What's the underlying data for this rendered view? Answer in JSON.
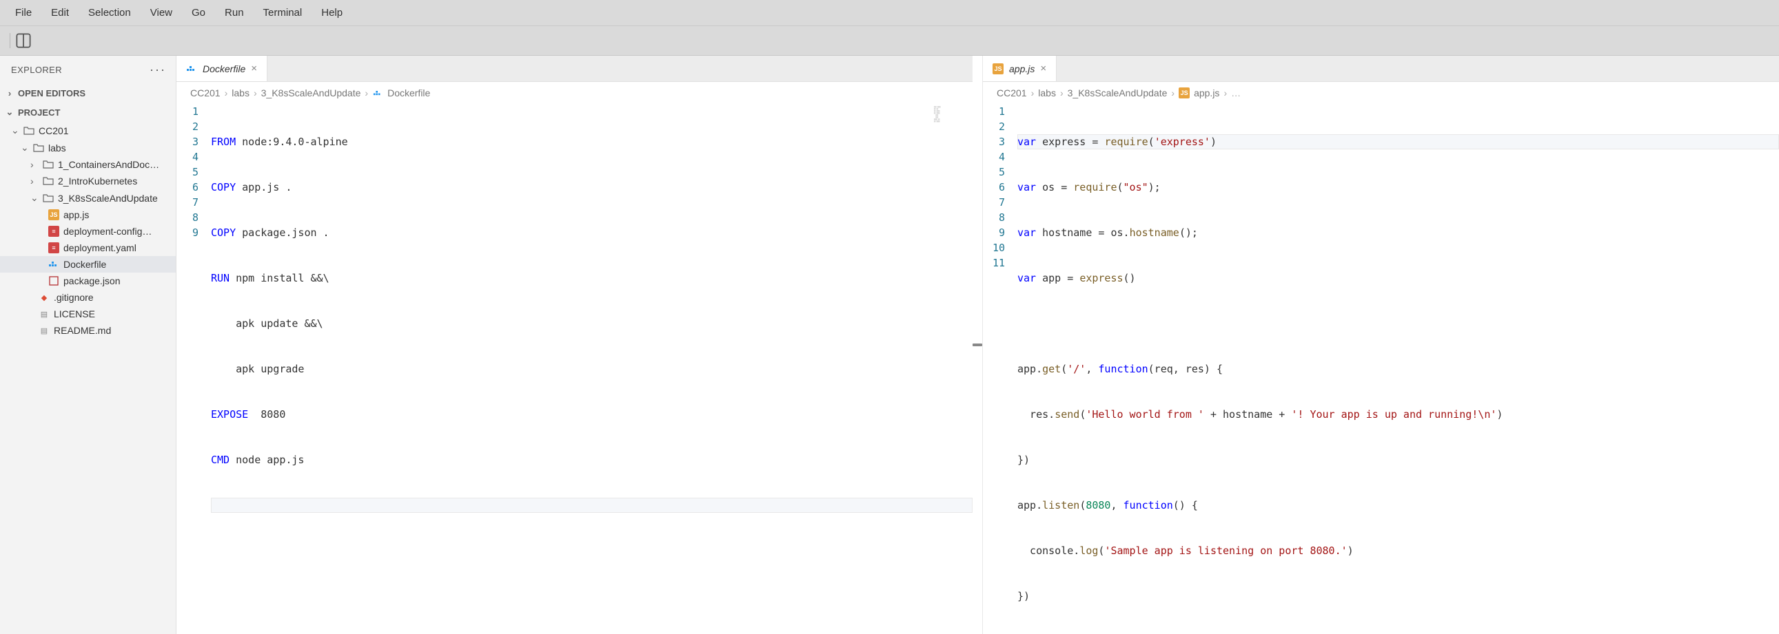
{
  "menu": [
    "File",
    "Edit",
    "Selection",
    "View",
    "Go",
    "Run",
    "Terminal",
    "Help"
  ],
  "sidebar": {
    "title": "EXPLORER",
    "sections": {
      "openEditors": "OPEN EDITORS",
      "project": "PROJECT"
    },
    "tree": {
      "root": "CC201",
      "labs": "labs",
      "folder1": "1_ContainersAndDoc…",
      "folder2": "2_IntroKubernetes",
      "folder3": "3_K8sScaleAndUpdate",
      "files": {
        "appjs": "app.js",
        "depcfg": "deployment-config…",
        "depyaml": "deployment.yaml",
        "dockerfile": "Dockerfile",
        "pkg": "package.json"
      },
      "gitignore": ".gitignore",
      "license": "LICENSE",
      "readme": "README.md"
    }
  },
  "editorLeft": {
    "tab": {
      "label": "Dockerfile"
    },
    "breadcrumb": [
      "CC201",
      "labs",
      "3_K8sScaleAndUpdate",
      "Dockerfile"
    ],
    "lines": [
      {
        "n": 1,
        "t": "FROM",
        "rest": " node:9.4.0-alpine"
      },
      {
        "n": 2,
        "t": "COPY",
        "rest": " app.js ."
      },
      {
        "n": 3,
        "t": "COPY",
        "rest": " package.json ."
      },
      {
        "n": 4,
        "t": "RUN",
        "rest": " npm install &&\\"
      },
      {
        "n": 5,
        "t": "",
        "rest": "    apk update &&\\"
      },
      {
        "n": 6,
        "t": "",
        "rest": "    apk upgrade"
      },
      {
        "n": 7,
        "t": "EXPOSE",
        "rest": "  8080"
      },
      {
        "n": 8,
        "t": "CMD",
        "rest": " node app.js"
      },
      {
        "n": 9,
        "t": "",
        "rest": ""
      }
    ]
  },
  "editorRight": {
    "tab": {
      "label": "app.js"
    },
    "breadcrumb": [
      "CC201",
      "labs",
      "3_K8sScaleAndUpdate",
      "app.js",
      "…"
    ],
    "code": {
      "l1": {
        "a": "var",
        "b": " express = ",
        "fn": "require",
        "c": "(",
        "s": "'express'",
        "d": ")"
      },
      "l2": {
        "a": "var",
        "b": " os = ",
        "fn": "require",
        "c": "(",
        "s": "\"os\"",
        "d": ");"
      },
      "l3": {
        "a": "var",
        "b": " hostname = os.",
        "fn": "hostname",
        "c": "();"
      },
      "l4": {
        "a": "var",
        "b": " app = ",
        "fn": "express",
        "c": "()"
      },
      "l6": {
        "a": "app.",
        "fn": "get",
        "b": "(",
        "s": "'/'",
        "c": ", ",
        "kw": "function",
        "d": "(req, res) {"
      },
      "l7": {
        "a": "  res.",
        "fn": "send",
        "b": "(",
        "s": "'Hello world from '",
        "c": " + hostname + ",
        "s2": "'! Your app is up and running!\\n'",
        "d": ")"
      },
      "l8": {
        "a": "})"
      },
      "l9": {
        "a": "app.",
        "fn": "listen",
        "b": "(",
        "n": "8080",
        "c": ", ",
        "kw": "function",
        "d": "() {"
      },
      "l10": {
        "a": "  console.",
        "fn": "log",
        "b": "(",
        "s": "'Sample app is listening on port 8080.'",
        "c": ")"
      },
      "l11": {
        "a": "})"
      }
    },
    "lineNums": [
      1,
      2,
      3,
      4,
      5,
      6,
      7,
      8,
      9,
      10,
      11
    ]
  }
}
